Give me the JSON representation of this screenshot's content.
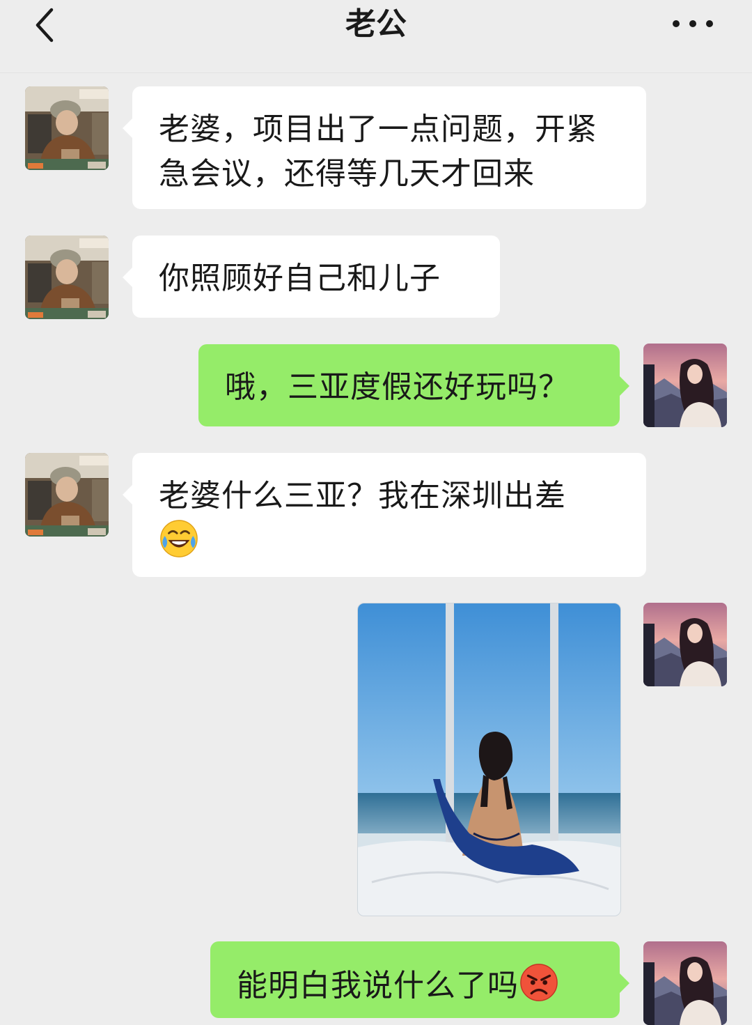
{
  "header": {
    "title": "老公",
    "back_icon": "chevron-left-icon",
    "more_icon": "more-dots-icon"
  },
  "messages": [
    {
      "side": "left",
      "text": "老婆，项目出了一点问题，开紧急会议，还得等几天才回来"
    },
    {
      "side": "left",
      "text": "你照顾好自己和儿子"
    },
    {
      "side": "right",
      "text": "哦，三亚度假还好玩吗？"
    },
    {
      "side": "left",
      "text": "老婆什么三亚？我在深圳出差",
      "emoji": "tears-of-joy-emoji"
    },
    {
      "side": "right",
      "type": "image",
      "image": "woman-at-seaside-window-photo"
    },
    {
      "side": "right",
      "text": "能明白我说什么了吗",
      "emoji": "angry-face-emoji"
    }
  ],
  "colors": {
    "background": "#ededed",
    "incoming_bubble": "#ffffff",
    "outgoing_bubble": "#95ec69"
  }
}
